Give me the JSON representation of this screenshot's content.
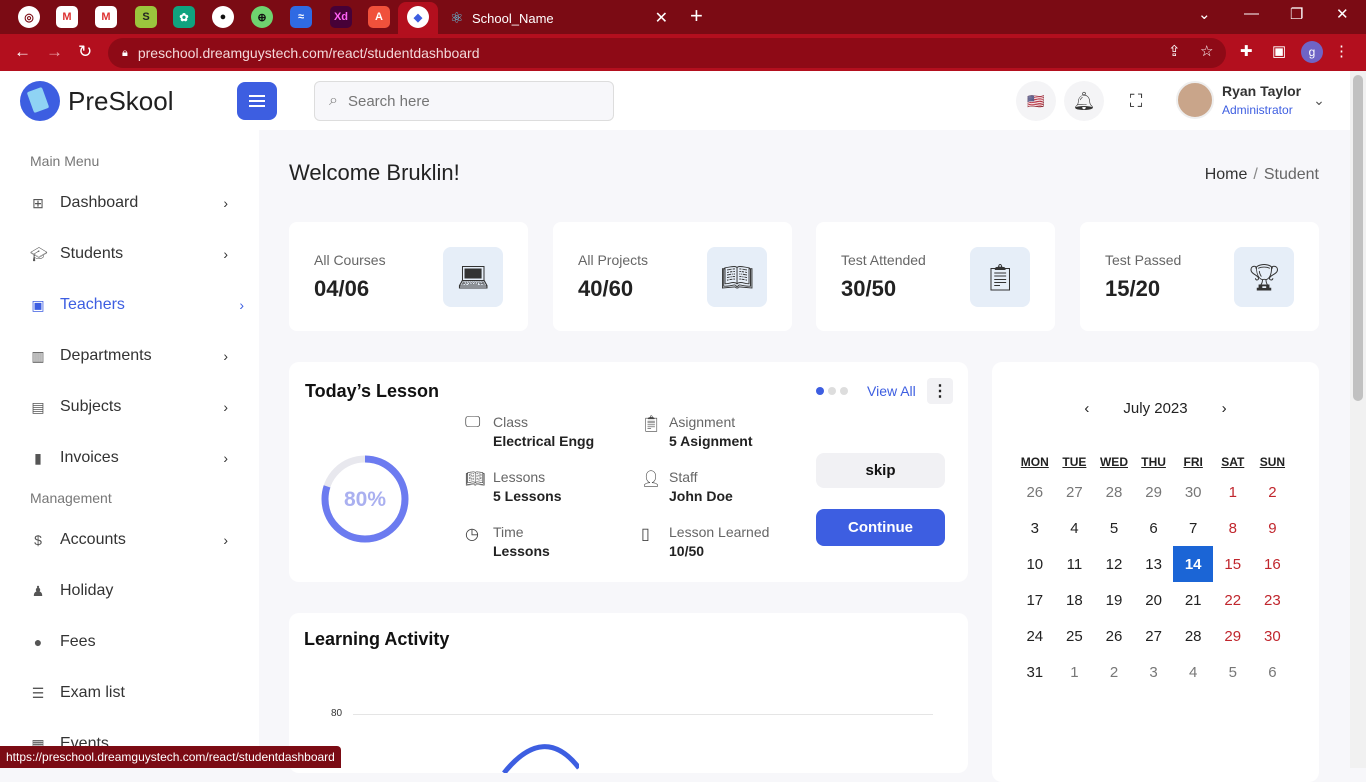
{
  "browser": {
    "tab_title": "School_Name",
    "url": "preschool.dreamguystech.com/react/studentdashboard",
    "status_url": "https://preschool.dreamguystech.com/react/studentdashboard",
    "profile_initial": "g"
  },
  "header": {
    "logo_text": "PreSkool",
    "search_placeholder": "Search here",
    "user_name": "Ryan Taylor",
    "user_role": "Administrator"
  },
  "sidebar": {
    "main_menu_label": "Main Menu",
    "management_label": "Management",
    "items": [
      {
        "label": "Dashboard",
        "icon": "grid-icon"
      },
      {
        "label": "Students",
        "icon": "graduation-cap-icon"
      },
      {
        "label": "Teachers",
        "icon": "teacher-icon"
      },
      {
        "label": "Departments",
        "icon": "building-icon"
      },
      {
        "label": "Subjects",
        "icon": "book-icon"
      },
      {
        "label": "Invoices",
        "icon": "clipboard-icon"
      }
    ],
    "mgmt_items": [
      {
        "label": "Accounts",
        "icon": "file-dollar-icon"
      },
      {
        "label": "Holiday",
        "icon": "person-icon"
      },
      {
        "label": "Fees",
        "icon": "coin-icon"
      },
      {
        "label": "Exam list",
        "icon": "list-icon"
      },
      {
        "label": "Events",
        "icon": "calendar-icon"
      }
    ],
    "active_color": "#3d5ee1"
  },
  "page": {
    "welcome": "Welcome Bruklin!",
    "breadcrumb_home": "Home",
    "breadcrumb_sep": "/",
    "breadcrumb_current": "Student"
  },
  "stats": [
    {
      "label": "All Courses",
      "value": "04/06"
    },
    {
      "label": "All Projects",
      "value": "40/60"
    },
    {
      "label": "Test Attended",
      "value": "30/50"
    },
    {
      "label": "Test Passed",
      "value": "15/20"
    }
  ],
  "lesson": {
    "title": "Today’s Lesson",
    "view_all": "View All",
    "progress_label": "80%",
    "progress": 0.8,
    "class_label": "Class",
    "class_value": "Electrical Engg",
    "lessons_label": "Lessons",
    "lessons_value": "5 Lessons",
    "time_label": "Time",
    "time_value": "Lessons",
    "assign_label": "Asignment",
    "assign_value": "5 Asignment",
    "staff_label": "Staff",
    "staff_value": "John Doe",
    "learned_label": "Lesson Learned",
    "learned_value": "10/50",
    "skip": "skip",
    "continue": "Continue"
  },
  "activity": {
    "title": "Learning Activity",
    "y_tick": "80"
  },
  "calendar": {
    "month": "July 2023",
    "prev": "‹",
    "next": "›",
    "dows": [
      "MON",
      "TUE",
      "WED",
      "THU",
      "FRI",
      "SAT",
      "SUN"
    ],
    "weeks": [
      [
        "26",
        "27",
        "28",
        "29",
        "30",
        "1",
        "2"
      ],
      [
        "3",
        "4",
        "5",
        "6",
        "7",
        "8",
        "9"
      ],
      [
        "10",
        "11",
        "12",
        "13",
        "14",
        "15",
        "16"
      ],
      [
        "17",
        "18",
        "19",
        "20",
        "21",
        "22",
        "23"
      ],
      [
        "24",
        "25",
        "26",
        "27",
        "28",
        "29",
        "30"
      ],
      [
        "31",
        "1",
        "2",
        "3",
        "4",
        "5",
        "6"
      ]
    ],
    "today": "14"
  }
}
